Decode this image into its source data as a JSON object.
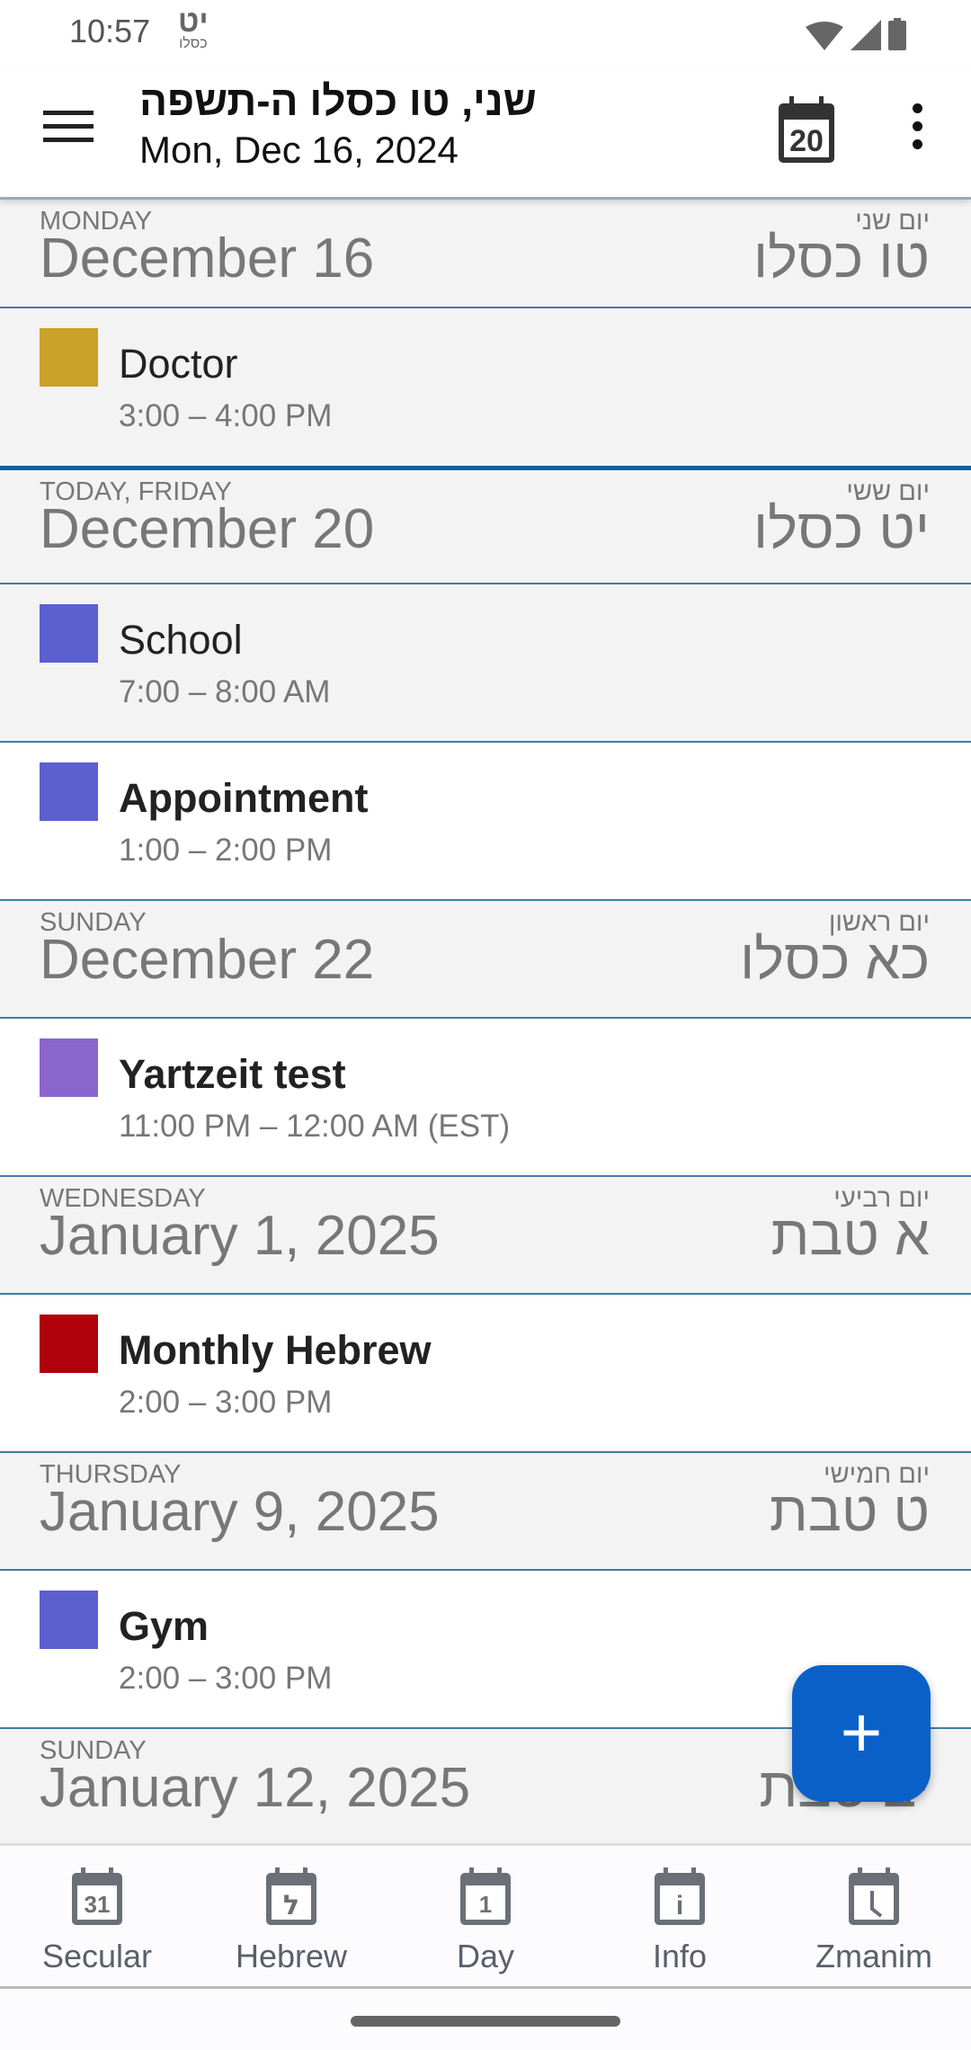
{
  "status_bar": {
    "time": "10:57",
    "hebrew_day": "יט",
    "hebrew_month": "כסלו",
    "icons": [
      "wifi-icon",
      "signal-icon",
      "battery-icon"
    ]
  },
  "app_bar": {
    "title": "שני, טו כסלו ה-תשפה",
    "subtitle": "Mon, Dec 16, 2024",
    "today_icon_number": "20"
  },
  "days": [
    {
      "label": "MONDAY",
      "date": "December 16",
      "hebrew_label": "יום שני",
      "hebrew_date": "טו כסלו",
      "events": [
        {
          "title": "Doctor",
          "time": "3:00 – 4:00 PM",
          "color": "#c9a227"
        }
      ]
    },
    {
      "label": "TODAY, FRIDAY",
      "date": "December 20",
      "hebrew_label": "יום ששי",
      "hebrew_date": "יט כסלו",
      "events": [
        {
          "title": "School",
          "time": "7:00 – 8:00 AM",
          "color": "#5b5fd0"
        },
        {
          "title": "Appointment",
          "time": "1:00 – 2:00 PM",
          "color": "#5b5fd0"
        }
      ]
    },
    {
      "label": "SUNDAY",
      "date": "December 22",
      "hebrew_label": "יום ראשון",
      "hebrew_date": "כא כסלו",
      "events": [
        {
          "title": "Yartzeit test",
          "time": "11:00 PM – 12:00 AM (EST)",
          "color": "#8a66cc"
        }
      ]
    },
    {
      "label": "WEDNESDAY",
      "date": "January 1, 2025",
      "hebrew_label": "יום רביעי",
      "hebrew_date": "א טבת",
      "events": [
        {
          "title": "Monthly Hebrew",
          "time": "2:00 – 3:00 PM",
          "color": "#b0000b"
        }
      ]
    },
    {
      "label": "THURSDAY",
      "date": "January 9, 2025",
      "hebrew_label": "יום חמישי",
      "hebrew_date": "ט טבת",
      "events": [
        {
          "title": "Gym",
          "time": "2:00 – 3:00 PM",
          "color": "#5b5fd0"
        }
      ]
    },
    {
      "label": "SUNDAY",
      "date": "January 12, 2025",
      "hebrew_label": "",
      "hebrew_date": "יב טבת",
      "events": []
    }
  ],
  "fab": {
    "label": "+"
  },
  "bottom_nav": [
    {
      "label": "Secular",
      "glyph": "31"
    },
    {
      "label": "Hebrew",
      "glyph": "ל"
    },
    {
      "label": "Day",
      "glyph": "1"
    },
    {
      "label": "Info",
      "glyph": "i"
    },
    {
      "label": "Zmanim",
      "glyph": ""
    }
  ],
  "colors": {
    "accent": "#0b60c8",
    "now_line": "#0b5fa8",
    "divider": "#3f7fa0"
  }
}
